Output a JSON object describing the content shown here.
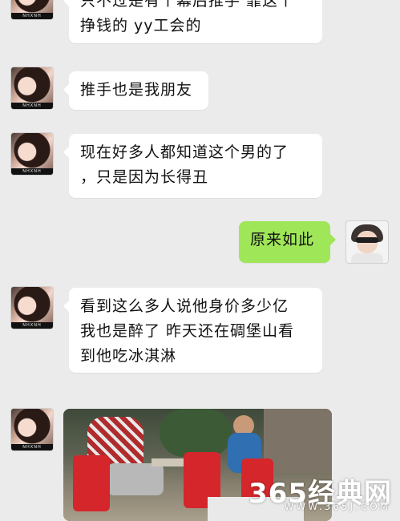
{
  "messages": [
    {
      "side": "left",
      "lines": [
        "只不过是有个幕后推手 靠这个",
        "挣钱的 yy工会的"
      ]
    },
    {
      "side": "left",
      "lines": [
        "推手也是我朋友"
      ]
    },
    {
      "side": "left",
      "lines": [
        "现在好多人都知道这个男的了",
        "，只是因为长得丑"
      ]
    },
    {
      "side": "right",
      "lines": [
        "原来如此"
      ]
    },
    {
      "side": "left",
      "lines": [
        "看到这么多人说他身价多少亿",
        "我也是醉了 昨天还在碉堡山看",
        "到他吃冰淇淋"
      ]
    }
  ],
  "avatar_label": "NHXNH",
  "watermark": {
    "brand": "365经典网",
    "url": "WWW.365J.COM"
  },
  "colors": {
    "background": "#ebebeb",
    "bubble_left": "#ffffff",
    "bubble_right": "#9fe658"
  }
}
